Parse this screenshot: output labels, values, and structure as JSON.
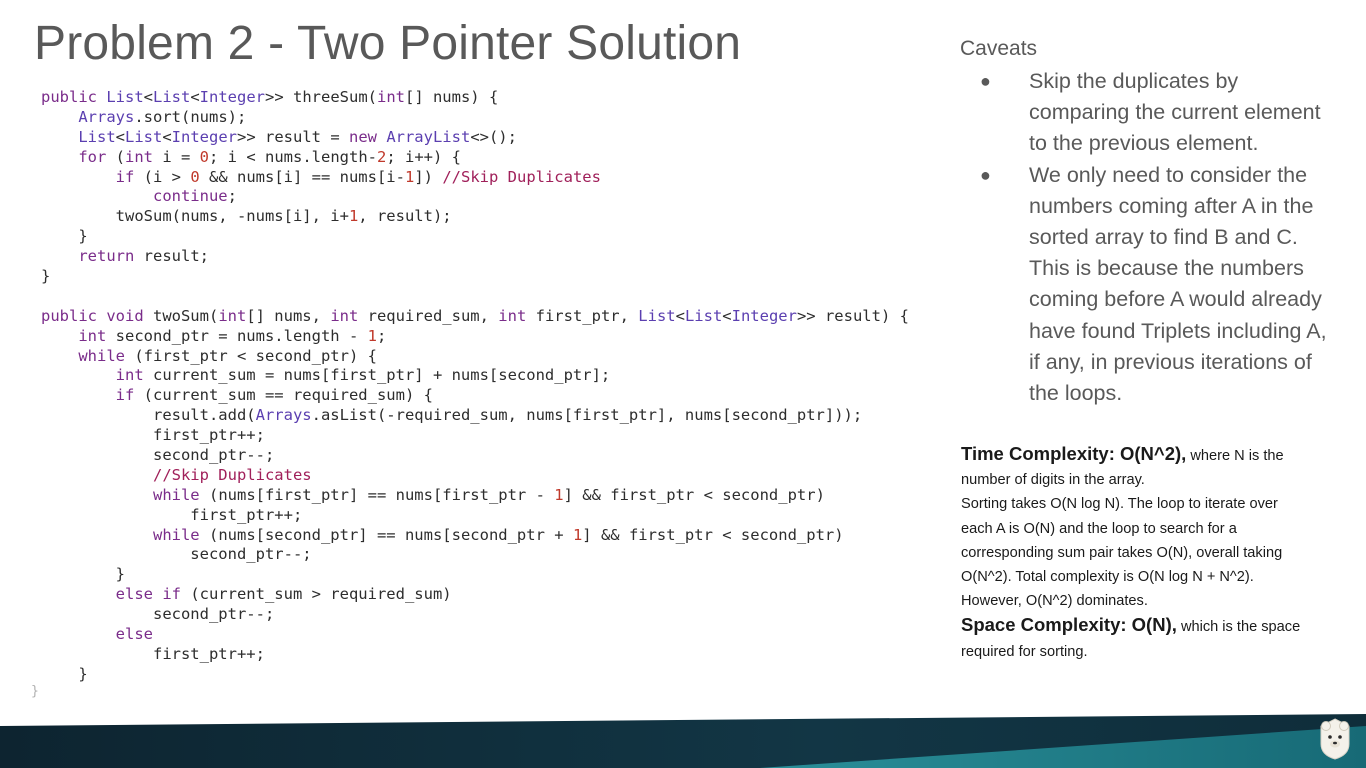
{
  "slide": {
    "title": "Problem 2 - Two Pointer Solution"
  },
  "code": {
    "lines": [
      [
        [
          "kw",
          "public "
        ],
        [
          "class",
          "List"
        ],
        [
          "plain",
          "<"
        ],
        [
          "class",
          "List"
        ],
        [
          "plain",
          "<"
        ],
        [
          "class",
          "Integer"
        ],
        [
          "plain",
          ">> threeSum("
        ],
        [
          "kw",
          "int"
        ],
        [
          "plain",
          "[] nums) {"
        ]
      ],
      [
        [
          "plain",
          "    "
        ],
        [
          "class",
          "Arrays"
        ],
        [
          "plain",
          ".sort(nums);"
        ]
      ],
      [
        [
          "plain",
          "    "
        ],
        [
          "class",
          "List"
        ],
        [
          "plain",
          "<"
        ],
        [
          "class",
          "List"
        ],
        [
          "plain",
          "<"
        ],
        [
          "class",
          "Integer"
        ],
        [
          "plain",
          ">> result = "
        ],
        [
          "kw",
          "new "
        ],
        [
          "class",
          "ArrayList"
        ],
        [
          "plain",
          "<>();"
        ]
      ],
      [
        [
          "plain",
          "    "
        ],
        [
          "kw",
          "for"
        ],
        [
          "plain",
          " ("
        ],
        [
          "kw",
          "int"
        ],
        [
          "plain",
          " i = "
        ],
        [
          "num",
          "0"
        ],
        [
          "plain",
          "; i < nums.length-"
        ],
        [
          "num",
          "2"
        ],
        [
          "plain",
          "; i++) {"
        ]
      ],
      [
        [
          "plain",
          "        "
        ],
        [
          "kw",
          "if"
        ],
        [
          "plain",
          " (i > "
        ],
        [
          "num",
          "0"
        ],
        [
          "plain",
          " && nums[i] == nums[i-"
        ],
        [
          "num",
          "1"
        ],
        [
          "plain",
          "]) "
        ],
        [
          "cmt",
          "//Skip Duplicates"
        ]
      ],
      [
        [
          "plain",
          "            "
        ],
        [
          "kw",
          "continue"
        ],
        [
          "plain",
          ";"
        ]
      ],
      [
        [
          "plain",
          "        twoSum(nums, -nums[i], i+"
        ],
        [
          "num",
          "1"
        ],
        [
          "plain",
          ", result);"
        ]
      ],
      [
        [
          "plain",
          "    }"
        ]
      ],
      [
        [
          "plain",
          "    "
        ],
        [
          "kw",
          "return"
        ],
        [
          "plain",
          " result;"
        ]
      ],
      [
        [
          "plain",
          "}"
        ]
      ],
      [
        [
          "plain",
          ""
        ]
      ],
      [
        [
          "kw",
          "public void "
        ],
        [
          "plain",
          "twoSum("
        ],
        [
          "kw",
          "int"
        ],
        [
          "plain",
          "[] nums, "
        ],
        [
          "kw",
          "int"
        ],
        [
          "plain",
          " required_sum, "
        ],
        [
          "kw",
          "int"
        ],
        [
          "plain",
          " first_ptr, "
        ],
        [
          "class",
          "List"
        ],
        [
          "plain",
          "<"
        ],
        [
          "class",
          "List"
        ],
        [
          "plain",
          "<"
        ],
        [
          "class",
          "Integer"
        ],
        [
          "plain",
          ">> result) {"
        ]
      ],
      [
        [
          "plain",
          "    "
        ],
        [
          "kw",
          "int"
        ],
        [
          "plain",
          " second_ptr = nums.length - "
        ],
        [
          "num",
          "1"
        ],
        [
          "plain",
          ";"
        ]
      ],
      [
        [
          "plain",
          "    "
        ],
        [
          "kw",
          "while"
        ],
        [
          "plain",
          " (first_ptr < second_ptr) {"
        ]
      ],
      [
        [
          "plain",
          "        "
        ],
        [
          "kw",
          "int"
        ],
        [
          "plain",
          " current_sum = nums[first_ptr] + nums[second_ptr];"
        ]
      ],
      [
        [
          "plain",
          "        "
        ],
        [
          "kw",
          "if"
        ],
        [
          "plain",
          " (current_sum == required_sum) {"
        ]
      ],
      [
        [
          "plain",
          "            result.add("
        ],
        [
          "class",
          "Arrays"
        ],
        [
          "plain",
          ".asList(-required_sum, nums[first_ptr], nums[second_ptr]));"
        ]
      ],
      [
        [
          "plain",
          "            first_ptr++;"
        ]
      ],
      [
        [
          "plain",
          "            second_ptr--;"
        ]
      ],
      [
        [
          "plain",
          "            "
        ],
        [
          "cmt",
          "//Skip Duplicates"
        ]
      ],
      [
        [
          "plain",
          "            "
        ],
        [
          "kw",
          "while"
        ],
        [
          "plain",
          " (nums[first_ptr] == nums[first_ptr - "
        ],
        [
          "num",
          "1"
        ],
        [
          "plain",
          "] && first_ptr < second_ptr)"
        ]
      ],
      [
        [
          "plain",
          "                first_ptr++;"
        ]
      ],
      [
        [
          "plain",
          "            "
        ],
        [
          "kw",
          "while"
        ],
        [
          "plain",
          " (nums[second_ptr] == nums[second_ptr + "
        ],
        [
          "num",
          "1"
        ],
        [
          "plain",
          "] && first_ptr < second_ptr)"
        ]
      ],
      [
        [
          "plain",
          "                second_ptr--;"
        ]
      ],
      [
        [
          "plain",
          "        }"
        ]
      ],
      [
        [
          "plain",
          "        "
        ],
        [
          "kw",
          "else if"
        ],
        [
          "plain",
          " (current_sum > required_sum)"
        ]
      ],
      [
        [
          "plain",
          "            second_ptr--;"
        ]
      ],
      [
        [
          "plain",
          "        "
        ],
        [
          "kw",
          "else"
        ]
      ],
      [
        [
          "plain",
          "            first_ptr++;"
        ]
      ],
      [
        [
          "plain",
          "    }"
        ]
      ]
    ],
    "stray_brace": "}"
  },
  "caveats": {
    "heading": "Caveats",
    "bullet_glyph": "●",
    "items": [
      [
        "Skip the duplicates by",
        "comparing the current element",
        "to the previous element."
      ],
      [
        "We only need to consider the",
        "numbers coming after A in the",
        "sorted array to find B and C.",
        "This is because the numbers",
        "coming before A would already",
        "have found Triplets including A,",
        "if any, in previous iterations of",
        "the loops."
      ]
    ]
  },
  "complexity": {
    "time_label": "Time Complexity: O(N^2),",
    "time_text_1": " where N is the",
    "time_text_2": "number of digits in the array.",
    "sorting_lines": [
      "Sorting takes O(N log N). The loop to iterate over",
      "each A is O(N) and the loop to search for a",
      "corresponding sum pair takes O(N), overall taking",
      "O(N^2). Total complexity is O(N log N + N^2).",
      "However, O(N^2) dominates."
    ],
    "space_label": "Space Complexity: O(N),",
    "space_text_1": " which is the space",
    "space_text_2": "required for sorting."
  },
  "colors": {
    "title": "#595959",
    "keyword": "#7a2c8a",
    "class_name": "#5b3fb0",
    "number": "#c0392b",
    "comment": "#a0205a",
    "band_dark": "#0f2d3a",
    "band_teal": "#1d7a86"
  },
  "logo": {
    "icon": "bear-mascot-icon"
  }
}
